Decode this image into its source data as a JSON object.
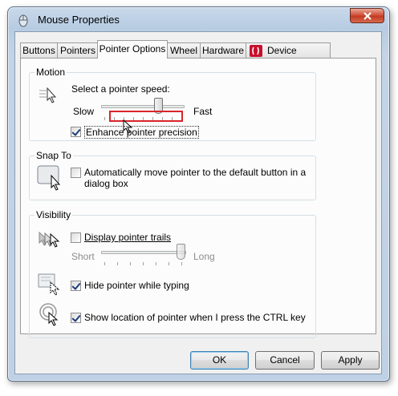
{
  "window": {
    "title": "Mouse Properties"
  },
  "tabs": [
    {
      "label": "Buttons"
    },
    {
      "label": "Pointers"
    },
    {
      "label": "Pointer Options"
    },
    {
      "label": "Wheel"
    },
    {
      "label": "Hardware"
    },
    {
      "label": "Device Settings"
    }
  ],
  "motion": {
    "group_label": "Motion",
    "speed_label": "Select a pointer speed:",
    "slow_label": "Slow",
    "fast_label": "Fast",
    "speed_value_fraction": 0.75,
    "enhance_label": "Enhance pointer precision",
    "enhance_checked": true
  },
  "snap_to": {
    "group_label": "Snap To",
    "auto_move_label_line1": "Automatically move pointer to the default button in a",
    "auto_move_label_line2": "dialog box",
    "auto_move_checked": false
  },
  "visibility": {
    "group_label": "Visibility",
    "trails_label": "Display pointer trails",
    "trails_checked": false,
    "short_label": "Short",
    "long_label": "Long",
    "hide_label": "Hide pointer while typing",
    "hide_checked": true,
    "show_location_label": "Show location of pointer when I press the CTRL key",
    "show_location_checked": true
  },
  "buttons": {
    "ok": "OK",
    "cancel": "Cancel",
    "apply": "Apply"
  },
  "colors": {
    "highlight_box": "#d9242b",
    "close_button": "#c8432b"
  }
}
